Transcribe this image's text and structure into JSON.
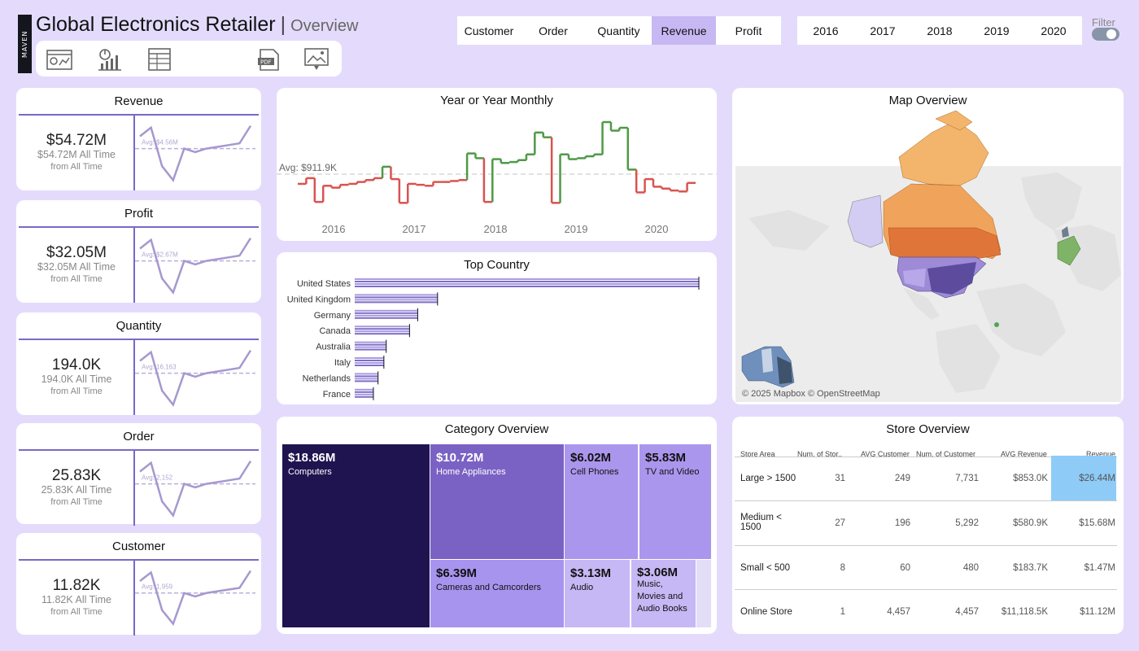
{
  "header": {
    "logo_text": "MAVEN",
    "title": "Global Electronics Retailer",
    "separator": "|",
    "subtitle": "Overview",
    "nav_icons": [
      "dashboard-icon",
      "analytics-icon",
      "table-report-icon",
      "pdf-download-icon",
      "image-download-icon"
    ]
  },
  "metrics": {
    "options": [
      "Customer",
      "Order",
      "Quantity",
      "Revenue",
      "Profit"
    ],
    "selected": "Revenue"
  },
  "years": {
    "options": [
      "2016",
      "2017",
      "2018",
      "2019",
      "2020"
    ]
  },
  "filter": {
    "label": "Filter",
    "on": true
  },
  "kpis": [
    {
      "title": "Revenue",
      "value": "$54.72M",
      "all_time": "$54.72M All Time",
      "from": "from All Time",
      "avg_label": "Avg: $4.56M",
      "trend": [
        0.7,
        1.2,
        -1.0,
        -1.8,
        0.0,
        -0.2,
        0.0,
        0.1,
        0.2,
        0.3,
        1.3
      ]
    },
    {
      "title": "Profit",
      "value": "$32.05M",
      "all_time": "$32.05M All Time",
      "from": "from All Time",
      "avg_label": "Avg: $2.67M",
      "trend": [
        0.7,
        1.2,
        -1.0,
        -1.8,
        0.0,
        -0.2,
        0.0,
        0.1,
        0.2,
        0.3,
        1.3
      ]
    },
    {
      "title": "Quantity",
      "value": "194.0K",
      "all_time": "194.0K All Time",
      "from": "from All Time",
      "avg_label": "Avg: 16,163",
      "trend": [
        0.7,
        1.2,
        -1.0,
        -1.8,
        0.0,
        -0.2,
        0.0,
        0.1,
        0.2,
        0.3,
        1.3
      ]
    },
    {
      "title": "Order",
      "value": "25.83K",
      "all_time": "25.83K All Time",
      "from": "from All Time",
      "avg_label": "Avg: 2,152",
      "trend": [
        0.7,
        1.2,
        -1.0,
        -1.8,
        0.0,
        -0.2,
        0.0,
        0.1,
        0.2,
        0.3,
        1.3
      ]
    },
    {
      "title": "Customer",
      "value": "11.82K",
      "all_time": "11.82K All Time",
      "from": "from All Time",
      "avg_label": "Avg: 1,959",
      "trend": [
        0.7,
        1.2,
        -1.0,
        -1.8,
        0.0,
        -0.2,
        0.0,
        0.1,
        0.2,
        0.3,
        1.3
      ]
    }
  ],
  "year_monthly": {
    "title": "Year or Year Monthly",
    "avg_label": "Avg: $911.9K",
    "x_labels": [
      "2016",
      "2017",
      "2018",
      "2019",
      "2020"
    ]
  },
  "top_country": {
    "title": "Top Country"
  },
  "map": {
    "title": "Map Overview",
    "attribution": "© 2025 Mapbox © OpenStreetMap"
  },
  "category": {
    "title": "Category Overview",
    "items": [
      {
        "value": "$18.86M",
        "name": "Computers",
        "color": "#1f1450"
      },
      {
        "value": "$10.72M",
        "name": "Home Appliances",
        "color": "#7a62c4"
      },
      {
        "value": "$6.02M",
        "name": "Cell Phones",
        "color": "#ab96ee",
        "dark": true
      },
      {
        "value": "$5.83M",
        "name": "TV and Video",
        "color": "#ab96ee",
        "dark": true
      },
      {
        "value": "$6.39M",
        "name": "Cameras and Camcorders",
        "color": "#a794ee",
        "dark": true
      },
      {
        "value": "$3.13M",
        "name": "Audio",
        "color": "#c6b8f4",
        "dark": true
      },
      {
        "value": "$3.06M",
        "name": "Music, Movies and Audio Books",
        "color": "#c6b8f4",
        "dark": true
      }
    ]
  },
  "store": {
    "title": "Store Overview",
    "columns": [
      "Store Area",
      "Num. of Stor..",
      "AVG Customer",
      "Num. of Customer",
      "AVG Revenue",
      "Revenue"
    ],
    "rows": [
      [
        "Large > 1500",
        "31",
        "249",
        "7,731",
        "$853.0K",
        "$26.44M"
      ],
      [
        "Medium < 1500",
        "27",
        "196",
        "5,292",
        "$580.9K",
        "$15.68M"
      ],
      [
        "Small < 500",
        "8",
        "60",
        "480",
        "$183.7K",
        "$1.47M"
      ],
      [
        "Online Store",
        "1",
        "4,457",
        "4,457",
        "$11,118.5K",
        "$11.12M"
      ]
    ],
    "highlight_color": "#8ecbf7"
  },
  "chart_data": [
    {
      "type": "line",
      "title": "Year or Year Monthly",
      "xlabel": "",
      "ylabel": "",
      "x_tick_labels": [
        "2016",
        "2017",
        "2018",
        "2019",
        "2020"
      ],
      "avg": 911.9,
      "avg_label": "Avg: $911.9K",
      "series": [
        {
          "values": [
            810,
            870,
            620,
            790,
            770,
            800,
            810,
            830,
            850,
            870,
            990,
            860,
            610,
            810,
            800,
            790,
            830,
            830,
            840,
            850,
            1130,
            1080,
            620,
            1070,
            1030,
            1040,
            1060,
            1120,
            1350,
            1300,
            610,
            1120,
            1070,
            1080,
            1100,
            1120,
            1460,
            1370,
            1400,
            960,
            720,
            860,
            780,
            760,
            740,
            730,
            820
          ]
        }
      ]
    },
    {
      "type": "bar",
      "title": "Top Country",
      "categories": [
        "United States",
        "United Kingdom",
        "Germany",
        "Canada",
        "Australia",
        "Italy",
        "Netherlands",
        "France"
      ],
      "values": [
        29.5,
        7.1,
        5.4,
        4.7,
        2.7,
        2.5,
        2.0,
        1.6
      ]
    },
    {
      "type": "heatmap",
      "title": "Category Overview",
      "categories": [
        "Computers",
        "Home Appliances",
        "Cameras and Camcorders",
        "Cell Phones",
        "TV and Video",
        "Audio",
        "Music, Movies and Audio Books"
      ],
      "values": [
        18.86,
        10.72,
        6.39,
        6.02,
        5.83,
        3.13,
        3.06
      ]
    }
  ]
}
